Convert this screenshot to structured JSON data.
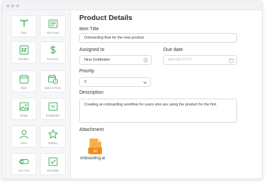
{
  "sidebar": {
    "items": [
      {
        "label": "Text",
        "icon": "text-icon"
      },
      {
        "label": "Text Area",
        "icon": "text-area-icon"
      },
      {
        "label": "Number",
        "icon": "number-icon"
      },
      {
        "label": "Currency",
        "icon": "currency-icon"
      },
      {
        "label": "Date",
        "icon": "date-icon"
      },
      {
        "label": "Date & Time",
        "icon": "date-time-icon"
      },
      {
        "label": "Image",
        "icon": "image-icon"
      },
      {
        "label": "Dropdown",
        "icon": "dropdown-icon"
      },
      {
        "label": "User",
        "icon": "user-icon"
      },
      {
        "label": "Rating",
        "icon": "rating-icon"
      },
      {
        "label": "Yes / No",
        "icon": "toggle-icon"
      },
      {
        "label": "Checklist",
        "icon": "checklist-icon"
      }
    ]
  },
  "form": {
    "title": "Product Details",
    "item_title": {
      "label": "Item Title",
      "value": "Onboarding flow for the new product"
    },
    "assigned_to": {
      "label": "Assigned to",
      "value": "Nina Goldhaber"
    },
    "due_date": {
      "label": "Due date",
      "placeholder": "MM-DD-YYYY"
    },
    "priority": {
      "label": "Priority",
      "value": "3"
    },
    "description": {
      "label": "Description",
      "value": "Creating an onboarding workflow for users who are using the product for the first"
    },
    "attachment": {
      "label": "Attachment",
      "file_name": "onboarding.ai",
      "file_badge": "Ai"
    }
  },
  "colors": {
    "accent_green": "#3fae5a",
    "file_orange": "#f08b1f"
  }
}
